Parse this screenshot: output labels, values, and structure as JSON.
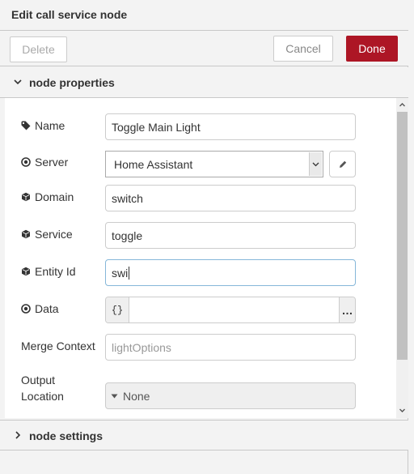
{
  "tray": {
    "title": "Edit call service node",
    "delete_label": "Delete",
    "cancel_label": "Cancel",
    "done_label": "Done"
  },
  "sections": {
    "properties_label": "node properties",
    "settings_label": "node settings"
  },
  "form": {
    "name": {
      "label": "Name",
      "value": "Toggle Main Light",
      "icon": "tag-icon"
    },
    "server": {
      "label": "Server",
      "selected": "Home Assistant",
      "icon": "dot-circle-icon"
    },
    "domain": {
      "label": "Domain",
      "value": "switch",
      "icon": "cube-icon"
    },
    "service": {
      "label": "Service",
      "value": "toggle",
      "icon": "cube-icon"
    },
    "entity_id": {
      "label": "Entity Id",
      "value": "swi",
      "icon": "cube-icon"
    },
    "data": {
      "label": "Data",
      "type_label": "{}",
      "expand_label": "…",
      "icon": "dot-circle-icon"
    },
    "merge_context": {
      "label": "Merge Context",
      "placeholder": "lightOptions"
    },
    "output_location": {
      "label_line1": "Output",
      "label_line2": "Location",
      "selected": "None"
    }
  },
  "colors": {
    "done_button": "#ad1625",
    "focus_border": "#85b7d9",
    "panel_background": "#f3f3f3"
  }
}
